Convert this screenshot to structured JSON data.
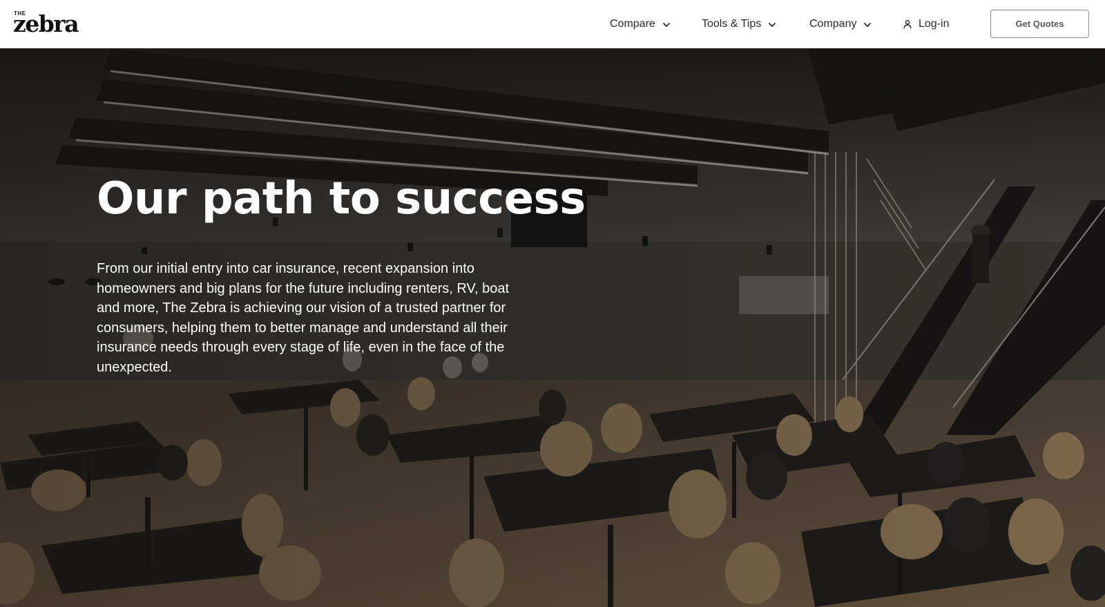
{
  "header": {
    "logo": {
      "small_text": "THE",
      "word_text": "zebra"
    },
    "nav": {
      "compare": "Compare",
      "tools": "Tools & Tips",
      "company": "Company",
      "login": "Log-in"
    },
    "cta": "Get Quotes"
  },
  "hero": {
    "title": "Our path to success",
    "body": "From our initial entry into car insurance, recent expansion into homeowners and big plans for the future including renters, RV, boat and more, The Zebra is achieving our vision of a trusted partner for consumers, helping them to better manage and understand all their insurance needs through every stage of life, even in the face of the unexpected."
  },
  "icons": {
    "chevron": "chevron-down-icon",
    "user": "user-icon"
  },
  "colors": {
    "header_bg": "#ffffff",
    "nav_text": "#2a2a2a",
    "cta_border": "#8a8a8a",
    "cta_text": "#5a5a5a",
    "hero_text": "#ffffff"
  }
}
